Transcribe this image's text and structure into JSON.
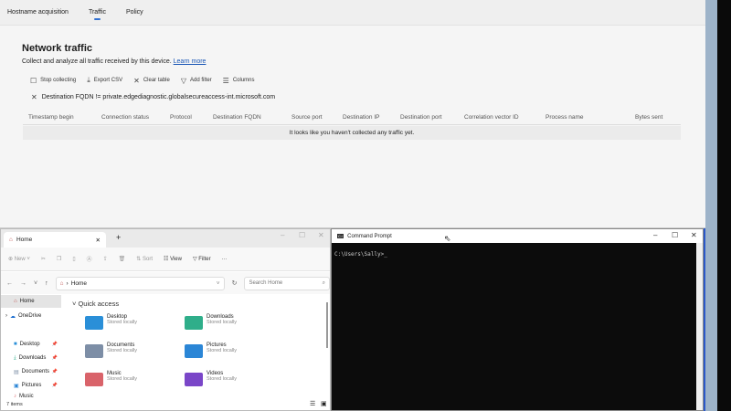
{
  "top": {
    "tabs": [
      {
        "label": "Hostname acquisition"
      },
      {
        "label": "Traffic",
        "active": true
      },
      {
        "label": "Policy"
      }
    ],
    "title": "Network traffic",
    "subtitle": "Collect and analyze all traffic received by this device.",
    "learn_more": "Learn more",
    "toolbar": [
      {
        "icon": "square-icon",
        "label": "Stop collecting"
      },
      {
        "icon": "download-icon",
        "label": "Export CSV"
      },
      {
        "icon": "close-icon",
        "label": "Clear table"
      },
      {
        "icon": "filter-icon",
        "label": "Add filter"
      },
      {
        "icon": "columns-icon",
        "label": "Columns"
      }
    ],
    "filter": "Destination FQDN != private.edgediagnostic.globalsecureaccess-int.microsoft.com",
    "columns": [
      "Timestamp begin",
      "Connection status",
      "Protocol",
      "Destination FQDN",
      "Source port",
      "Destination IP",
      "Destination port",
      "Correlation vector ID",
      "Process name",
      "Bytes sent"
    ],
    "empty": "It looks like you haven't collected any traffic yet."
  },
  "explorer": {
    "tab": "Home",
    "new_tab": "+",
    "new": "New",
    "sort": "Sort",
    "view": "View",
    "filter": "Filter",
    "more": "···",
    "address": "Home",
    "search_placeholder": "Search Home",
    "sidebar": [
      {
        "label": "Home",
        "icon": "home-icon"
      },
      {
        "label": "OneDrive",
        "icon": "cloud-icon"
      },
      {
        "label": "Desktop",
        "icon": "desktop-icon"
      },
      {
        "label": "Downloads",
        "icon": "download-icon"
      },
      {
        "label": "Documents",
        "icon": "document-icon"
      },
      {
        "label": "Pictures",
        "icon": "pictures-icon"
      },
      {
        "label": "Music",
        "icon": "music-icon"
      }
    ],
    "quick_access": "Quick access",
    "items": [
      {
        "name": "Desktop",
        "sub": "Stored locally",
        "color": "#2a8fd8"
      },
      {
        "name": "Downloads",
        "sub": "Stored locally",
        "color": "#2fae8a"
      },
      {
        "name": "Documents",
        "sub": "Stored locally",
        "color": "#7d8ea6"
      },
      {
        "name": "Pictures",
        "sub": "Stored locally",
        "color": "#2b86d6"
      },
      {
        "name": "Music",
        "sub": "Stored locally",
        "color": "#d9636a"
      },
      {
        "name": "Videos",
        "sub": "Stored locally",
        "color": "#7a46c8"
      }
    ],
    "status": "7 items"
  },
  "cmd": {
    "title": "Command Prompt",
    "prompt": "C:\\Users\\Sally>"
  }
}
